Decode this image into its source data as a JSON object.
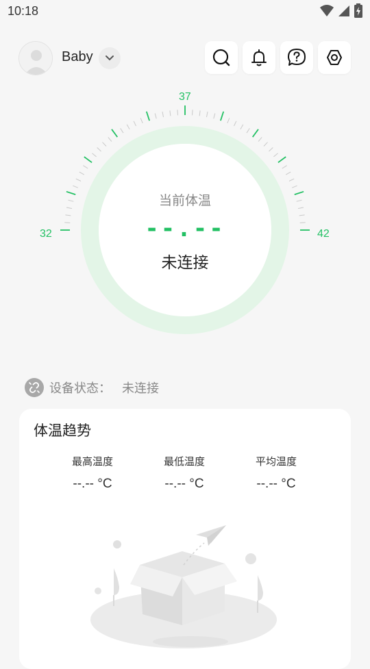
{
  "status_bar": {
    "time": "10:18",
    "icons": [
      "wifi-icon",
      "signal-icon",
      "battery-icon"
    ]
  },
  "profile": {
    "name": "Baby",
    "avatar_icon": "avatar-placeholder-icon"
  },
  "header_actions": [
    {
      "icon": "search-icon"
    },
    {
      "icon": "alarm-icon"
    },
    {
      "icon": "help-icon"
    },
    {
      "icon": "settings-icon"
    }
  ],
  "gauge": {
    "label": "当前体温",
    "value": "--.--",
    "status": "未连接",
    "min": "32",
    "mid": "37",
    "max": "42",
    "accent_color": "#22c063",
    "ring_color": "#e3f5e7"
  },
  "device": {
    "label": "设备状态：",
    "value": "未连接",
    "icon": "link-broken-icon"
  },
  "trend": {
    "title": "体温趋势",
    "stats": [
      {
        "label": "最高温度",
        "value": "--.-- °C"
      },
      {
        "label": "最低温度",
        "value": "--.-- °C"
      },
      {
        "label": "平均温度",
        "value": "--.-- °C"
      }
    ],
    "empty_icon": "empty-box-icon"
  }
}
